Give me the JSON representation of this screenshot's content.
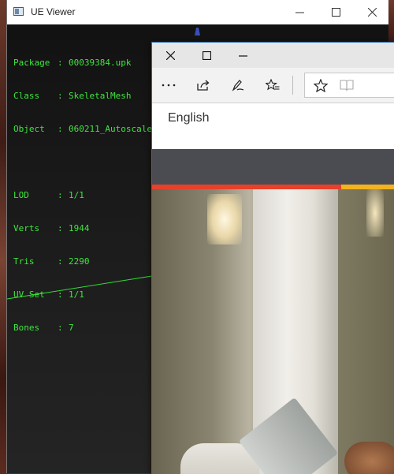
{
  "ue_viewer": {
    "title": "UE Viewer",
    "info": [
      {
        "key": "Package",
        "value": "00039384.upk"
      },
      {
        "key": "Class",
        "value": "SkeletalMesh"
      },
      {
        "key": "Object",
        "value": "060211_Autoscale"
      }
    ],
    "stats": [
      {
        "key": "LOD",
        "value": "1/1"
      },
      {
        "key": "Verts",
        "value": "1944"
      },
      {
        "key": "Tris",
        "value": "2290"
      },
      {
        "key": "UV Set",
        "value": "1/1"
      },
      {
        "key": "Bones",
        "value": "7"
      }
    ],
    "text_color": "#3ee63e"
  },
  "edge": {
    "language_label": "English",
    "accent_red": "#e8402a",
    "accent_yellow": "#f3b21e",
    "toolbar_icons": [
      "more-icon",
      "share-icon",
      "notes-icon",
      "hub-icon",
      "favorite-star-icon",
      "reading-view-icon"
    ]
  }
}
